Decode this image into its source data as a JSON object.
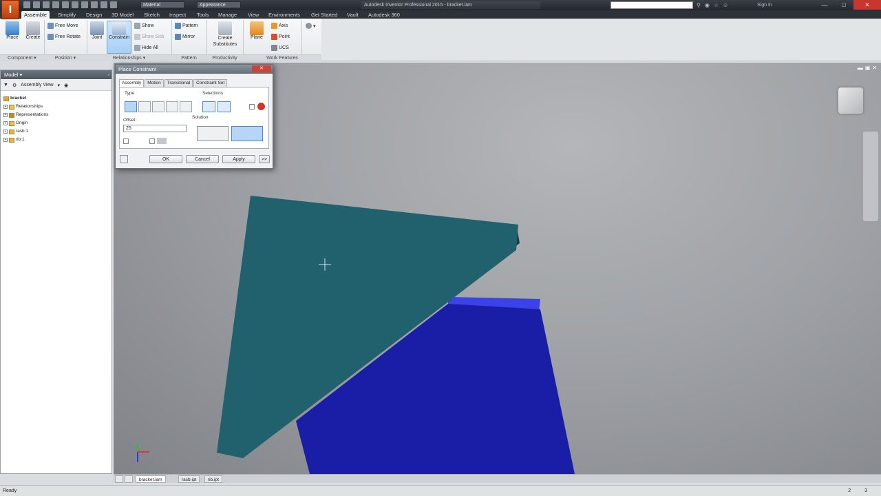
{
  "app": {
    "logo": "I",
    "title": "Autodesk Inventor Professional 2015 - bracket.iam"
  },
  "qat": {
    "material": "Material",
    "appearance": "Appearance"
  },
  "search": {
    "placeholder": ""
  },
  "signin": "Sign In",
  "window": {
    "min": "—",
    "max": "□",
    "close": "✕"
  },
  "ribbon": {
    "tabs": [
      "Assemble",
      "Simplify",
      "Design",
      "3D Model",
      "Sketch",
      "Inspect",
      "Tools",
      "Manage",
      "View",
      "Environments",
      "Get Started",
      "Vault",
      "Autodesk 360"
    ],
    "active_tab": 0,
    "buttons": {
      "place": "Place",
      "create": "Create",
      "free_move": "Free Move",
      "free_rotate": "Free Rotate",
      "joint": "Joint",
      "constrain": "Constrain",
      "show": "Show",
      "show_sick": "Show Sick",
      "hide_all": "Hide All",
      "pattern": "Pattern",
      "mirror": "Mirror",
      "create_substitutes": "Create Substitutes",
      "plane": "Plane",
      "axis": "Axis",
      "point": "Point",
      "ucs": "UCS"
    },
    "panels": {
      "component": "Component ▾",
      "position": "Position ▾",
      "relationships": "Relationships ▾",
      "pattern": "Pattern",
      "productivity": "Productivity",
      "work_features": "Work Features"
    }
  },
  "browser": {
    "title": "Model ▾",
    "view": "Assembly View",
    "items": [
      {
        "label": "bracket",
        "root": true
      },
      {
        "label": "Relationships"
      },
      {
        "label": "Representations"
      },
      {
        "label": "Origin"
      },
      {
        "label": "rasb:1"
      },
      {
        "label": "rib:1"
      }
    ]
  },
  "dialog": {
    "title": "Place Constraint",
    "close": "✕",
    "tabs": [
      "Assembly",
      "Motion",
      "Transitional",
      "Constraint Set"
    ],
    "type_label": "Type",
    "selections_label": "Selections",
    "offset_label": "Offset:",
    "offset_value": "25",
    "solution_label": "Solution",
    "ok": "OK",
    "cancel": "Cancel",
    "apply": "Apply",
    "more": ">>"
  },
  "doc_tabs": [
    "bracket.iam",
    "rasb.ipt",
    "rib.ipt"
  ],
  "status": {
    "text": "Ready",
    "n1": "2",
    "n2": "3"
  },
  "colors": {
    "rib": "#1f5f6b",
    "base": "#1b1fa0",
    "base_top": "#3a3fe6"
  }
}
